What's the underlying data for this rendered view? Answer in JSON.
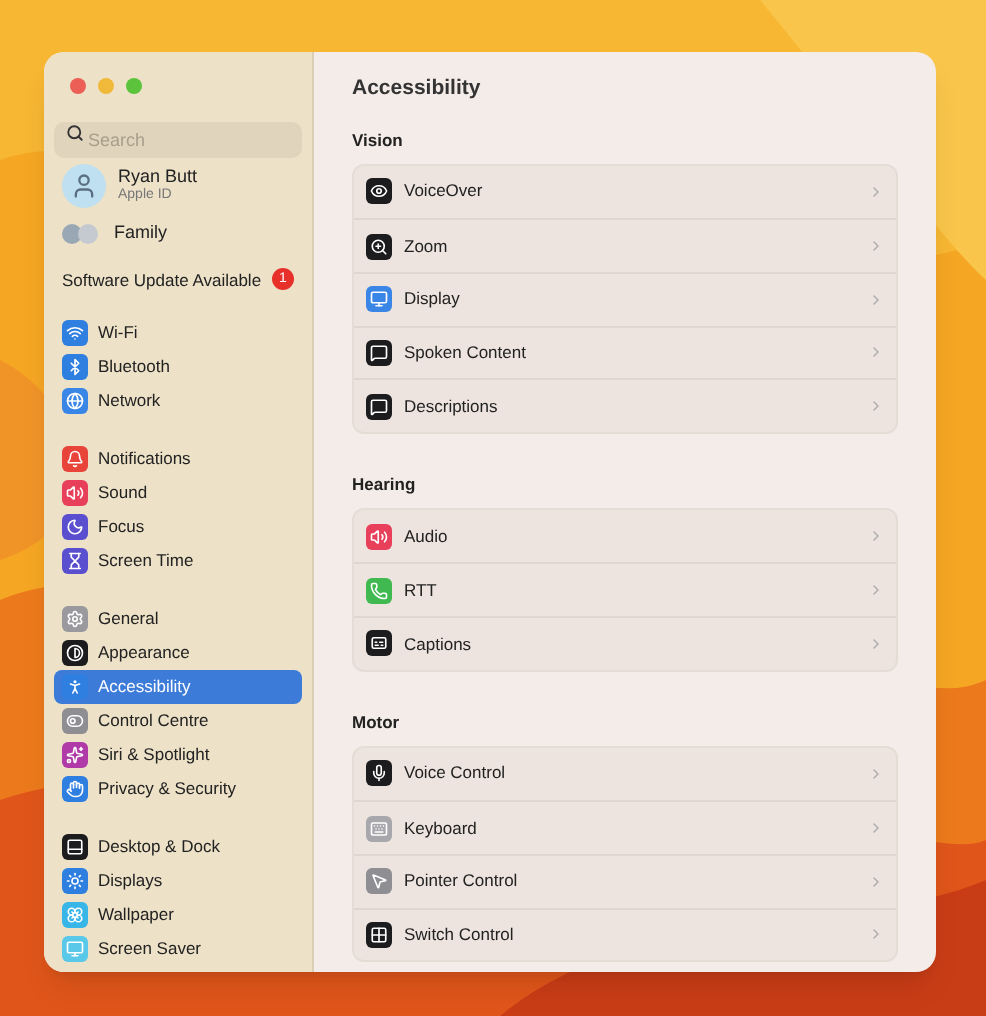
{
  "sidebar": {
    "search": {
      "placeholder": "Search"
    },
    "account": {
      "name": "Ryan Butt",
      "subtitle": "Apple ID"
    },
    "family": {
      "label": "Family"
    },
    "update": {
      "label": "Software Update Available",
      "badge": "1"
    },
    "groups": [
      [
        {
          "label": "Wi-Fi",
          "color": "#2f7fe0",
          "selected": false
        },
        {
          "label": "Bluetooth",
          "color": "#2f7fe0",
          "selected": false
        },
        {
          "label": "Network",
          "color": "#3a86e6",
          "selected": false
        }
      ],
      [
        {
          "label": "Notifications",
          "color": "#e8443a",
          "selected": false
        },
        {
          "label": "Sound",
          "color": "#e8405a",
          "selected": false
        },
        {
          "label": "Focus",
          "color": "#5a4fcf",
          "selected": false
        },
        {
          "label": "Screen Time",
          "color": "#5a4fcf",
          "selected": false
        }
      ],
      [
        {
          "label": "General",
          "color": "#9a9a9e",
          "selected": false
        },
        {
          "label": "Appearance",
          "color": "#1c1c1e",
          "selected": false
        },
        {
          "label": "Accessibility",
          "color": "#2f7fe0",
          "selected": true
        },
        {
          "label": "Control Centre",
          "color": "#8e8e93",
          "selected": false
        },
        {
          "label": "Siri & Spotlight",
          "color": "#b03aa8",
          "selected": false
        },
        {
          "label": "Privacy & Security",
          "color": "#2f7fe0",
          "selected": false
        }
      ],
      [
        {
          "label": "Desktop & Dock",
          "color": "#1c1c1e",
          "selected": false
        },
        {
          "label": "Displays",
          "color": "#2f7fe0",
          "selected": false
        },
        {
          "label": "Wallpaper",
          "color": "#38b6e8",
          "selected": false
        },
        {
          "label": "Screen Saver",
          "color": "#5ac8e8",
          "selected": false
        }
      ]
    ]
  },
  "content": {
    "title": "Accessibility",
    "sections": [
      {
        "heading": "Vision",
        "rows": [
          {
            "label": "VoiceOver",
            "color": "#1c1c1e"
          },
          {
            "label": "Zoom",
            "color": "#1c1c1e"
          },
          {
            "label": "Display",
            "color": "#3a86e6"
          },
          {
            "label": "Spoken Content",
            "color": "#1c1c1e"
          },
          {
            "label": "Descriptions",
            "color": "#1c1c1e"
          }
        ]
      },
      {
        "heading": "Hearing",
        "rows": [
          {
            "label": "Audio",
            "color": "#e8405a"
          },
          {
            "label": "RTT",
            "color": "#3fb950"
          },
          {
            "label": "Captions",
            "color": "#1c1c1e"
          }
        ]
      },
      {
        "heading": "Motor",
        "rows": [
          {
            "label": "Voice Control",
            "color": "#1c1c1e"
          },
          {
            "label": "Keyboard",
            "color": "#a8a8ac"
          },
          {
            "label": "Pointer Control",
            "color": "#8e8e93"
          },
          {
            "label": "Switch Control",
            "color": "#1c1c1e"
          }
        ]
      }
    ]
  }
}
